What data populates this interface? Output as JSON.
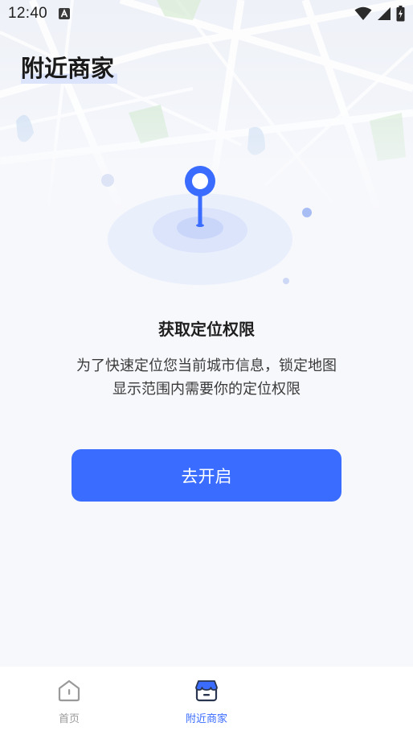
{
  "status_bar": {
    "time": "12:40",
    "icons": [
      "a-notification-icon",
      "wifi-icon",
      "signal-icon",
      "battery-charging-icon"
    ]
  },
  "page": {
    "title": "附近商家"
  },
  "permission": {
    "title": "获取定位权限",
    "description_line1": "为了快速定位您当前城市信息，锁定地图",
    "description_line2": "显示范围内需要你的定位权限",
    "enable_button_label": "去开启"
  },
  "bottom_nav": {
    "items": [
      {
        "label": "首页",
        "icon": "home-icon",
        "active": false
      },
      {
        "label": "附近商家",
        "icon": "store-icon",
        "active": true
      }
    ]
  },
  "colors": {
    "accent": "#3a6cff",
    "inactive": "#9a9a9a",
    "background": "#f7f8fc"
  }
}
